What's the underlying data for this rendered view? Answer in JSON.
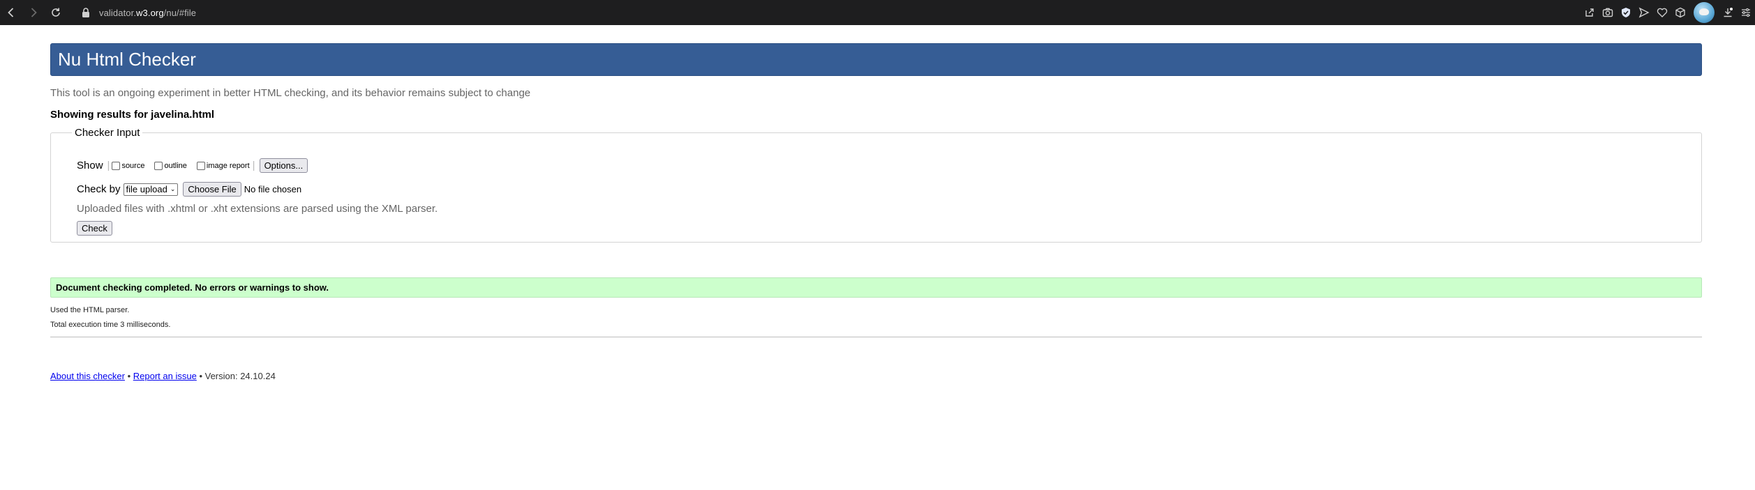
{
  "browser": {
    "url_prefix": "validator.",
    "url_domain": "w3.org",
    "url_suffix": "/nu/#file"
  },
  "header": {
    "title": "Nu Html Checker"
  },
  "intro": "This tool is an ongoing experiment in better HTML checking, and its behavior remains subject to change",
  "showing": "Showing results for javelina.html",
  "checker_input": {
    "legend": "Checker Input",
    "show_label": "Show",
    "options": [
      {
        "label": "source",
        "checked": false
      },
      {
        "label": "outline",
        "checked": false
      },
      {
        "label": "image report",
        "checked": false
      }
    ],
    "options_button": "Options...",
    "check_by_label": "Check by",
    "check_by_value": "file upload",
    "choose_file_button": "Choose File",
    "no_file_text": "No file chosen",
    "xml_note": "Uploaded files with .xhtml or .xht extensions are parsed using the XML parser.",
    "check_button": "Check"
  },
  "results": {
    "success_message": "Document checking completed. No errors or warnings to show.",
    "parser_note": "Used the HTML parser.",
    "execution_time": "Total execution time 3 milliseconds."
  },
  "footer": {
    "about_link": "About this checker",
    "separator": "•",
    "report_link": "Report an issue",
    "version": "• Version: 24.10.24"
  }
}
